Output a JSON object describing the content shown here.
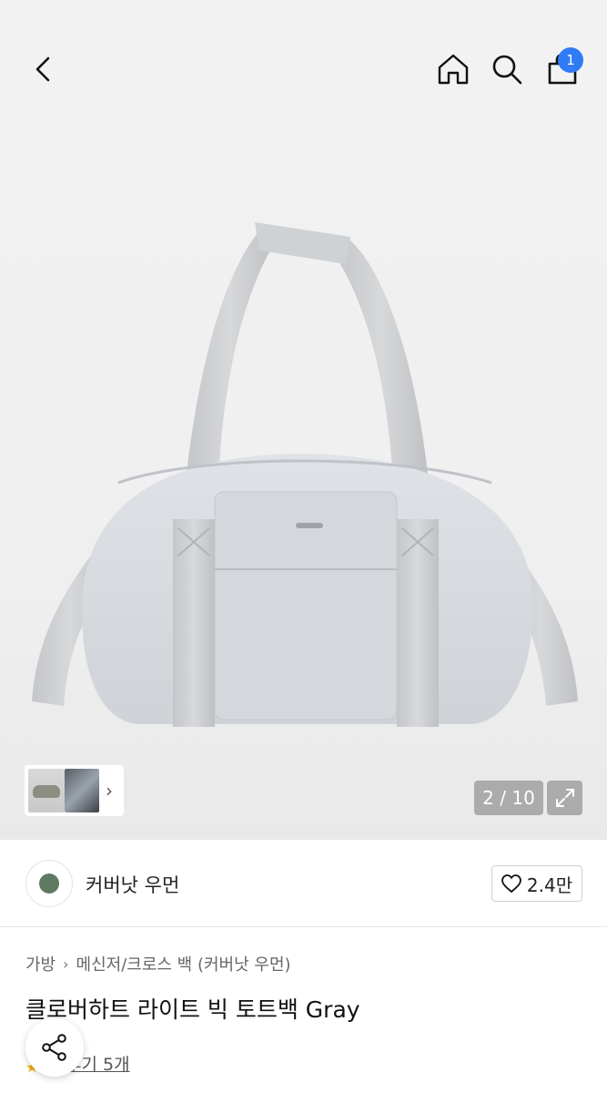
{
  "header": {
    "back_icon": "chevron-left-icon",
    "home_icon": "home-icon",
    "search_icon": "search-icon",
    "cart_icon": "shopping-bag-icon",
    "cart_badge": "1",
    "badge_color": "#2f7bf5"
  },
  "gallery": {
    "counter": "2 / 10",
    "expand_icon": "expand-icon",
    "thumb_arrow": "›"
  },
  "brand": {
    "name": "커버낫 우먼",
    "like_count": "2.4만",
    "like_icon": "heart-outline-icon"
  },
  "breadcrumb": {
    "category": "가방",
    "separator": "›",
    "subcategory": "메신저/크로스 백 (커버낫 우먼)"
  },
  "product": {
    "title": "클로버하트 라이트 빅 토트백 Gray",
    "reviews": "후기 5개"
  },
  "share": {
    "icon": "share-icon"
  }
}
